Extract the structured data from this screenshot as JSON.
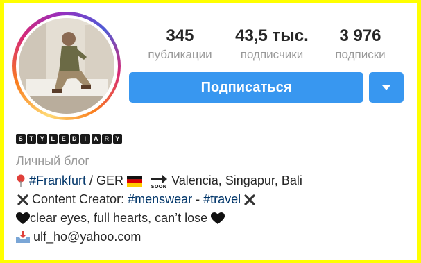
{
  "stats": [
    {
      "value": "345",
      "label": "публикации"
    },
    {
      "value": "43,5 тыс.",
      "label": "подписчики"
    },
    {
      "value": "3 976",
      "label": "подписки"
    }
  ],
  "follow_button": {
    "label": "Подписаться"
  },
  "username_letters": [
    "S",
    "T",
    "Y",
    "L",
    "E",
    "D",
    "I",
    "A",
    "R",
    "Y"
  ],
  "bio": {
    "category": "Личный блог",
    "line1": {
      "hashtag": "#Frankfurt",
      "text1": " / GER ",
      "text2": " Valencia, Singapur, Bali"
    },
    "line2": {
      "text1": " Content Creator: ",
      "tag1": "#menswear",
      "sep": " - ",
      "tag2": "#travel",
      "text2": " "
    },
    "line3": {
      "text": "clear eyes, full hearts, can’t lose "
    },
    "line4": {
      "email": " ulf_ho@yahoo.com"
    }
  },
  "colors": {
    "accent": "#3897f0",
    "hashtag": "#003569",
    "frame": "#ffff00",
    "muted": "#999999"
  },
  "icons": [
    "pin-icon",
    "german-flag-icon",
    "soon-arrow-icon",
    "cross-mark-icon",
    "black-heart-icon",
    "inbox-tray-icon",
    "chevron-down-icon"
  ]
}
